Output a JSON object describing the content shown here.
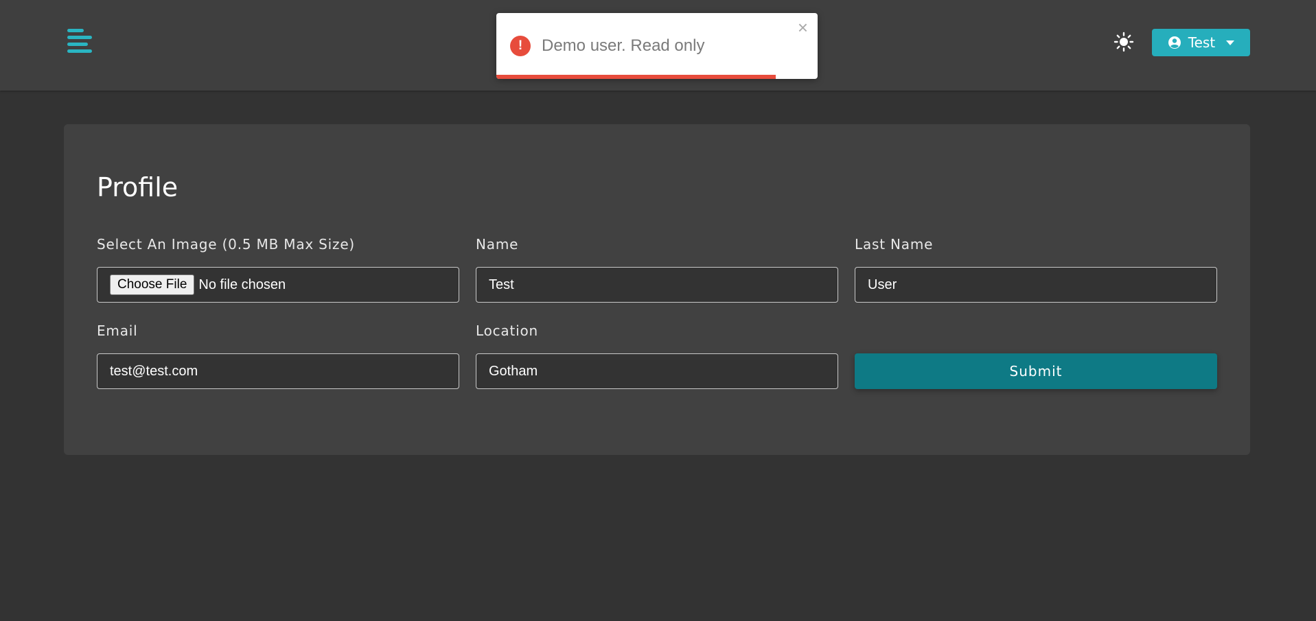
{
  "header": {
    "user_menu_label": "Test"
  },
  "toast": {
    "message": "Demo user. Read only",
    "close_glyph": "×",
    "icon_glyph": "!",
    "progress_remaining": 0.87,
    "status_color": "#e74c3c"
  },
  "profile": {
    "title": "Profile",
    "image_field": {
      "label": "Select An Image (0.5 MB Max Size)",
      "button_label": "Choose File",
      "status": "No file chosen"
    },
    "name_field": {
      "label": "Name",
      "value": "Test"
    },
    "last_name_field": {
      "label": "Last Name",
      "value": "User"
    },
    "email_field": {
      "label": "Email",
      "value": "test@test.com"
    },
    "location_field": {
      "label": "Location",
      "value": "Gotham"
    },
    "submit_label": "Submit"
  },
  "colors": {
    "accent": "#26aebc",
    "submit": "#0e7a85",
    "background": "#333333",
    "surface": "#414141"
  },
  "icons": {
    "menu": "menu-icon",
    "theme": "sun-icon",
    "user": "user-circle-icon",
    "caret": "caret-down-icon",
    "toast": "error-icon",
    "close": "close-icon"
  }
}
